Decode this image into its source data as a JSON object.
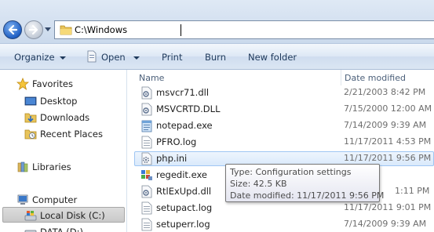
{
  "address_bar": {
    "path": "C:\\Windows"
  },
  "toolbar": {
    "organize": "Organize",
    "open": "Open",
    "print": "Print",
    "burn": "Burn",
    "new_folder": "New folder"
  },
  "nav_pane": {
    "favorites": "Favorites",
    "desktop": "Desktop",
    "downloads": "Downloads",
    "recent_places": "Recent Places",
    "libraries": "Libraries",
    "computer": "Computer",
    "local_disk": "Local Disk (C:)",
    "data_drive": "DATA (D:)"
  },
  "file_list": {
    "columns": {
      "name": "Name",
      "date_modified": "Date modified"
    },
    "rows": [
      {
        "name": "msvcr71.dll",
        "date": "2/21/2003 8:42 PM",
        "icon": "dll-icon"
      },
      {
        "name": "MSVCRTD.DLL",
        "date": "7/15/2000 12:00 AM",
        "icon": "dll-icon"
      },
      {
        "name": "notepad.exe",
        "date": "7/14/2009 9:39 AM",
        "icon": "notepad-icon"
      },
      {
        "name": "PFRO.log",
        "date": "11/17/2011 4:53 PM",
        "icon": "text-file-icon"
      },
      {
        "name": "php.ini",
        "date": "11/17/2011 9:56 PM",
        "icon": "config-file-icon"
      },
      {
        "name": "regedit.exe",
        "date": "",
        "icon": "regedit-icon"
      },
      {
        "name": "RtlExUpd.dll",
        "date": "1:11 PM",
        "icon": "dll-icon"
      },
      {
        "name": "setupact.log",
        "date": "11/17/2011 9:01 PM",
        "icon": "text-file-icon"
      },
      {
        "name": "setuperr.log",
        "date": "7/14/2009 9:39 AM",
        "icon": "text-file-icon"
      }
    ]
  },
  "tooltip": {
    "type": "Type: Configuration settings",
    "size": "Size: 42.5 KB",
    "date": "Date modified: 11/17/2011 9:56 PM"
  },
  "colors": {
    "highlight_border": "#9fc6f3",
    "toolbar_text": "#1e395b"
  }
}
